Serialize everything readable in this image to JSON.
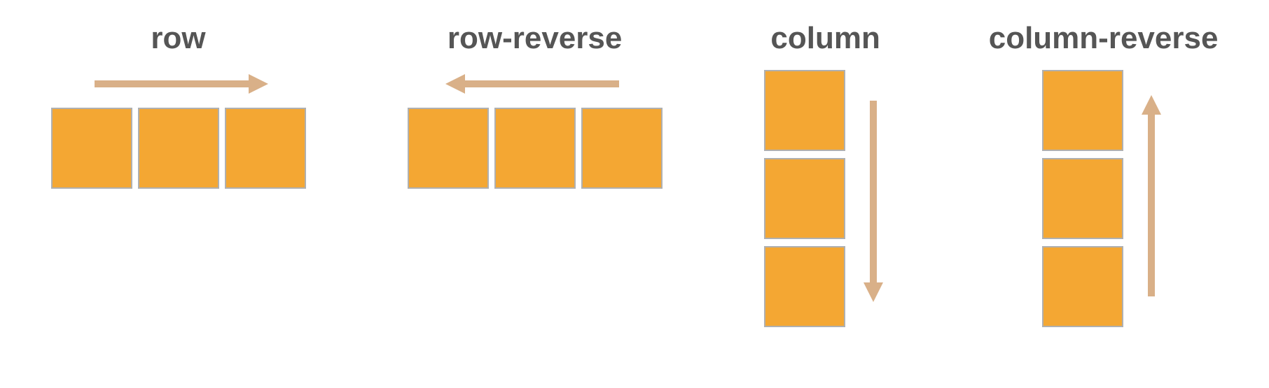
{
  "panels": {
    "row": {
      "label": "row"
    },
    "row_reverse": {
      "label": "row-reverse"
    },
    "column": {
      "label": "column"
    },
    "column_reverse": {
      "label": "column-reverse"
    }
  },
  "colors": {
    "box_fill": "#f4a733",
    "box_border": "#b0b0b0",
    "arrow": "#d9b088",
    "title": "#555555"
  }
}
